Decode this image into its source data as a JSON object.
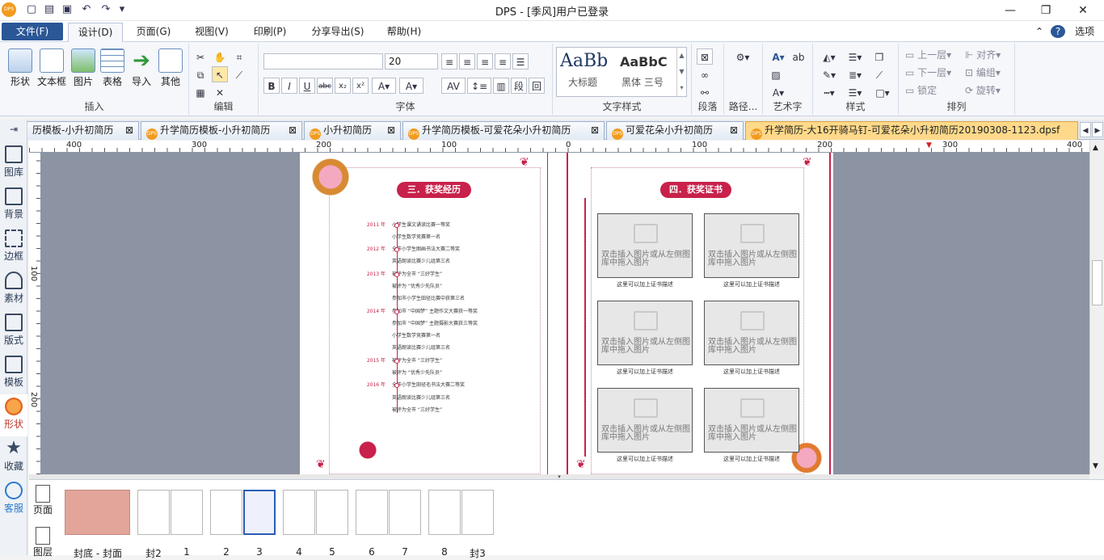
{
  "app": {
    "title": "DPS - [季风]用户已登录"
  },
  "menubar": {
    "file": "文件(F)",
    "items": [
      "设计(D)",
      "页面(G)",
      "视图(V)",
      "印刷(P)",
      "分享导出(S)",
      "帮助(H)"
    ],
    "options": "选项"
  },
  "ribbon": {
    "insert": {
      "label": "插入",
      "buttons": [
        "形状",
        "文本框",
        "图片",
        "表格",
        "导入",
        "其他"
      ]
    },
    "edit": {
      "label": "编辑"
    },
    "font": {
      "label": "字体",
      "font_name": "",
      "font_size": "20"
    },
    "textstyle": {
      "label": "文字样式",
      "sample1": "AaBb",
      "sample1_name": "大标题",
      "sample2": "AaBbC",
      "sample2_name": "黑体 三号"
    },
    "paragraph": {
      "label": "段落"
    },
    "path": {
      "label": "路径..."
    },
    "arttext": {
      "label": "艺术字"
    },
    "style": {
      "label": "样式"
    },
    "arrange": {
      "label": "排列",
      "buttons": [
        "上一层",
        "对齐",
        "下一层",
        "编组",
        "锁定",
        "旋转"
      ]
    }
  },
  "tabs": [
    {
      "label": "历模板-小升初简历"
    },
    {
      "label": "升学简历模板-小升初简历"
    },
    {
      "label": "小升初简历"
    },
    {
      "label": "升学简历模板-可爱花朵小升初简历"
    },
    {
      "label": "可爱花朵小升初简历"
    },
    {
      "label": "升学简历-大16开骑马钉-可爱花朵小升初简历20190308-1123.dpsf"
    }
  ],
  "sidebar": [
    "图库",
    "背景",
    "边框",
    "素材",
    "版式",
    "模板",
    "形状",
    "收藏",
    "客服"
  ],
  "ruler": {
    "h_labels": [
      "400",
      "300",
      "200",
      "100",
      "0",
      "100",
      "200",
      "300",
      "400"
    ],
    "v_labels": [
      "100",
      "200"
    ]
  },
  "page": {
    "left_heading": "三．获奖经历",
    "right_heading": "四．获奖证书",
    "timeline": [
      {
        "year": "2011 年",
        "text": "小学生课文诵读比赛一等奖"
      },
      {
        "year": "",
        "text": "小学生数学竞赛第一名"
      },
      {
        "year": "2012 年",
        "text": "全市小学生图画书法大赛二等奖"
      },
      {
        "year": "",
        "text": "英语朗读比赛少儿组第三名"
      },
      {
        "year": "2013 年",
        "text": "被评为全市 “三好学生”"
      },
      {
        "year": "",
        "text": "被评为 “优秀少先队员”"
      },
      {
        "year": "",
        "text": "参加市小学生田径比赛中获第三名"
      },
      {
        "year": "2014 年",
        "text": "参加市 “中国梦” 主题作文大赛获一等奖"
      },
      {
        "year": "",
        "text": "参加市 “中国梦” 主题摄影大赛获三等奖"
      },
      {
        "year": "",
        "text": "小学生数学竞赛第一名"
      },
      {
        "year": "",
        "text": "英语朗读比赛少儿组第三名"
      },
      {
        "year": "2015 年",
        "text": "被评为全市 “三好学生”"
      },
      {
        "year": "",
        "text": "被评为 “优秀少先队员”"
      },
      {
        "year": "2016 年",
        "text": "全市小学生田径毛书法大赛二等奖"
      },
      {
        "year": "",
        "text": "英语朗读比赛少儿组第三名"
      },
      {
        "year": "",
        "text": "被评为全市 “三好学生”"
      }
    ],
    "placeholder_text": "双击插入图片或从左侧图库中拖入图片",
    "caption": "这里可以加上证书描述"
  },
  "pagepanel": {
    "tab_page": "页面",
    "tab_other": "图层",
    "labels": [
      "封底 - 封面",
      "封2",
      "1",
      "2",
      "3",
      "4",
      "5",
      "6",
      "7",
      "8",
      "封3"
    ]
  },
  "colors": {
    "accent": "#c8214b",
    "file_menu": "#2b5797",
    "active_tab": "#ffd98a"
  }
}
